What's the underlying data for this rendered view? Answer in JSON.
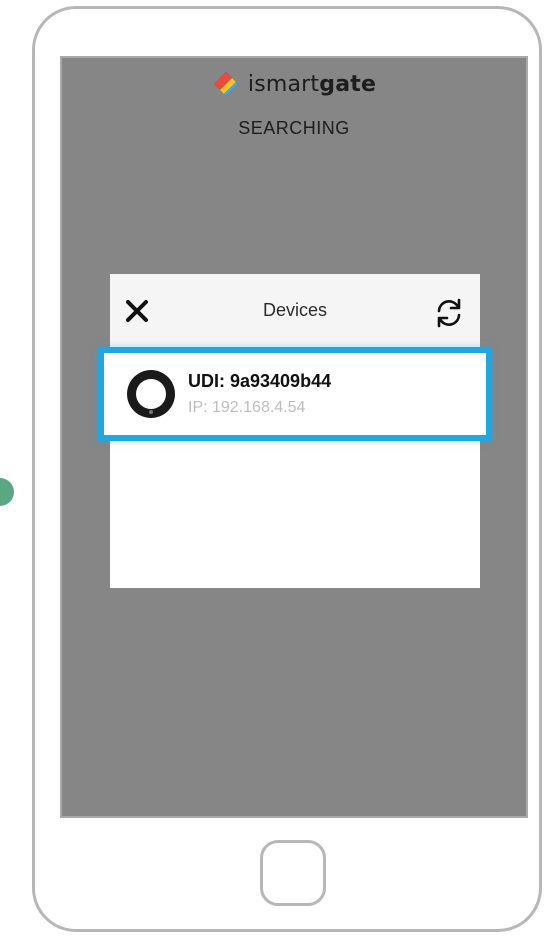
{
  "brand": {
    "name_light": "ismart",
    "name_bold": "gate",
    "logo_icon": "diamond-logo-icon"
  },
  "status": {
    "text": "SEARCHING"
  },
  "dialog": {
    "title": "Devices",
    "close_icon": "close-icon",
    "refresh_icon": "refresh-icon"
  },
  "devices": [
    {
      "udi": "UDI: 9a93409b44",
      "ip": "IP: 192.168.4.54",
      "icon": "device-ring-icon",
      "selected": true
    }
  ],
  "colors": {
    "screen_bg": "#878687",
    "highlight": "#1fa7e0",
    "ip_text": "#bdbdbd"
  }
}
